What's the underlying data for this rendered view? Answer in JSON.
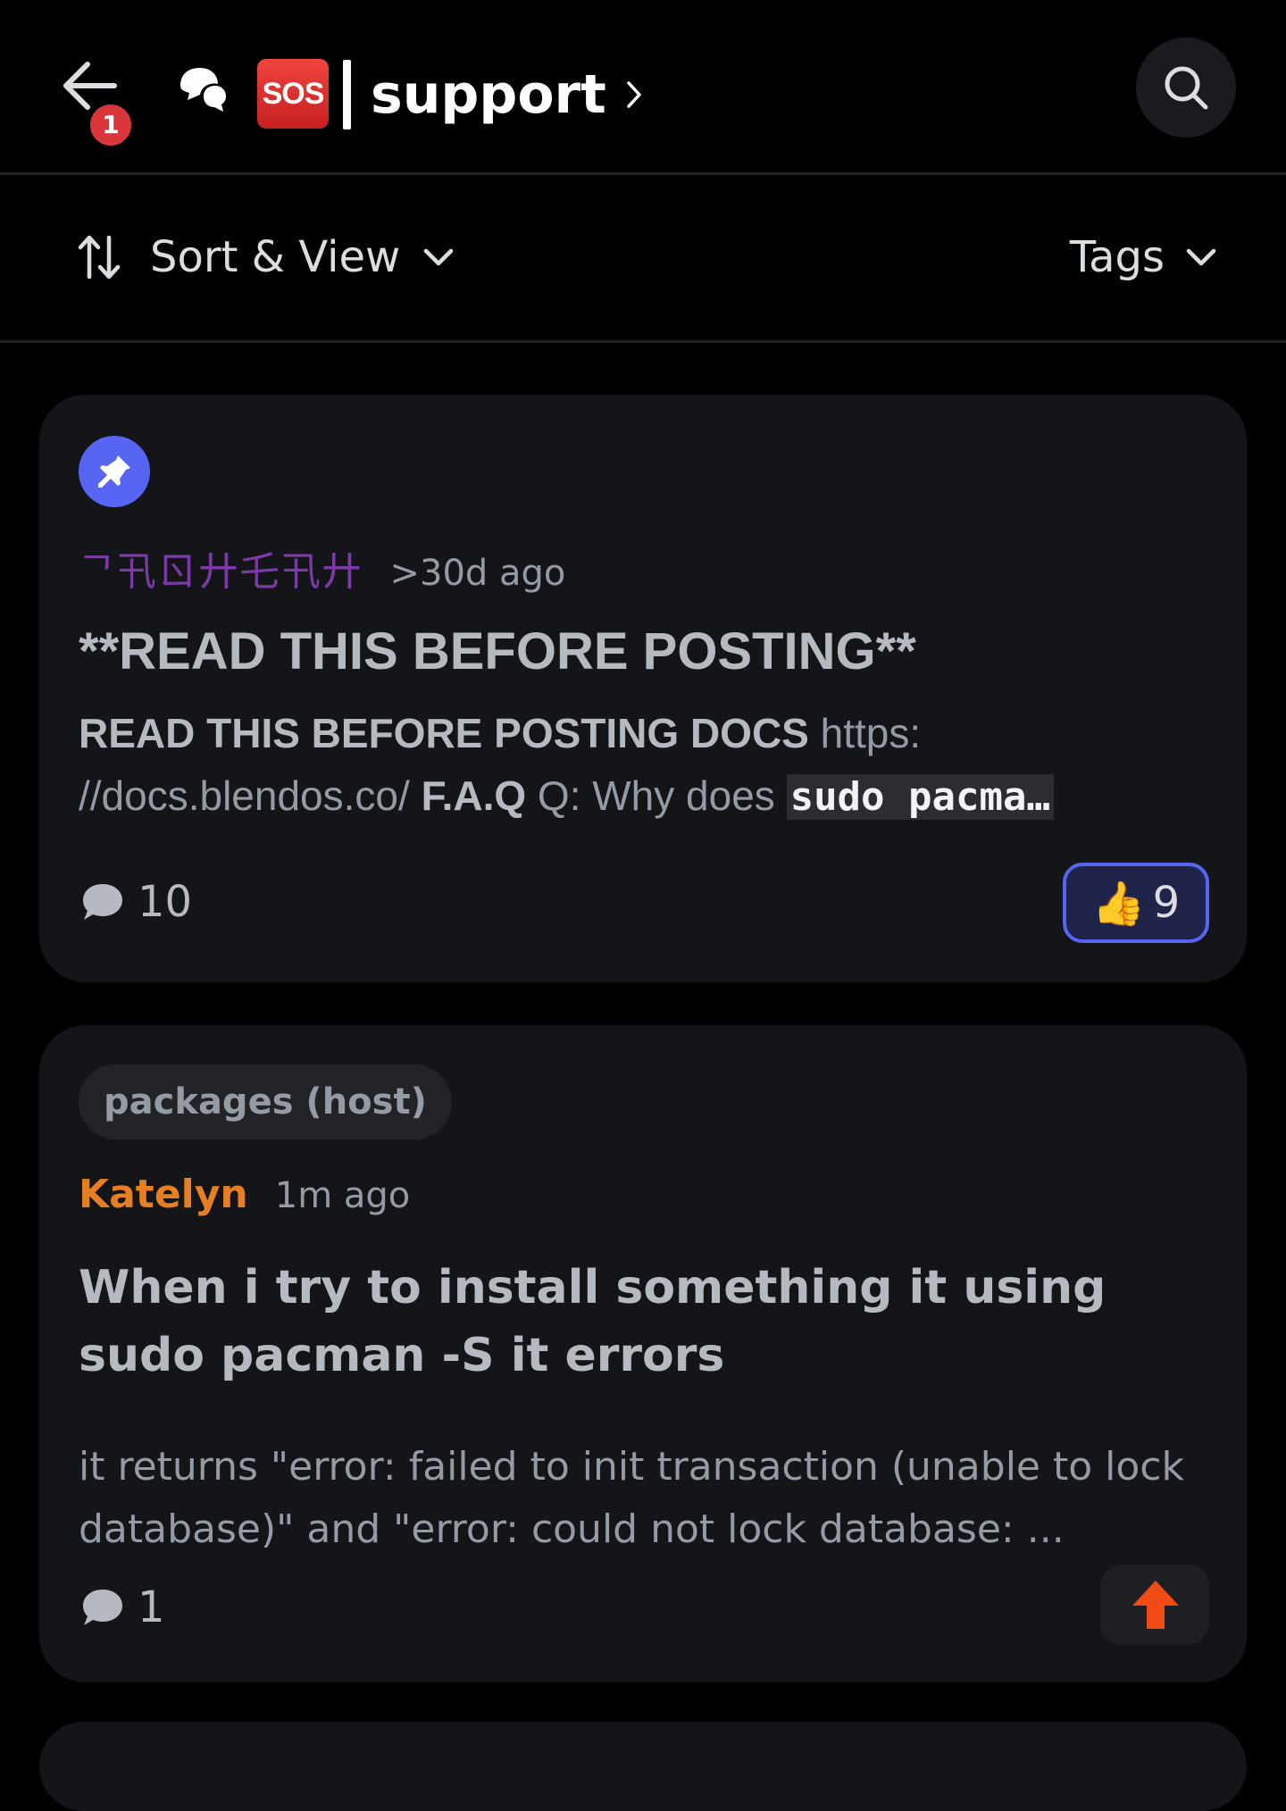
{
  "header": {
    "notification_count": "1",
    "sos_label": "SOS",
    "channel_name": "support"
  },
  "filters": {
    "sort_label": "Sort & View",
    "tags_label": "Tags"
  },
  "posts": [
    {
      "pinned": true,
      "author": "ᄀ卂ㄖ廾乇卂廾",
      "author_color": "#7b3aa6",
      "timestamp": ">30d ago",
      "title": "**READ THIS BEFORE POSTING**",
      "preview_bold1": "READ THIS BEFORE POSTING  DOCS",
      "preview_text1": " https: //docs.blendos.co/  ",
      "preview_bold2": "F.A.Q",
      "preview_text2": "  Q: Why does ",
      "preview_code": "sudo pacma…",
      "comment_count": "10",
      "reaction_emoji": "👍",
      "reaction_count": "9"
    },
    {
      "tag": "packages (host)",
      "author": "Katelyn",
      "author_color": "#e67e22",
      "timestamp": "1m ago",
      "title": "When i try to install something it using sudo pacman -S it errors",
      "preview": "it returns \"error: failed to init transaction (unable to lock database)\" and \"error: could not lock database: ...",
      "comment_count": "1",
      "upvote_color": "#f04a16"
    }
  ]
}
